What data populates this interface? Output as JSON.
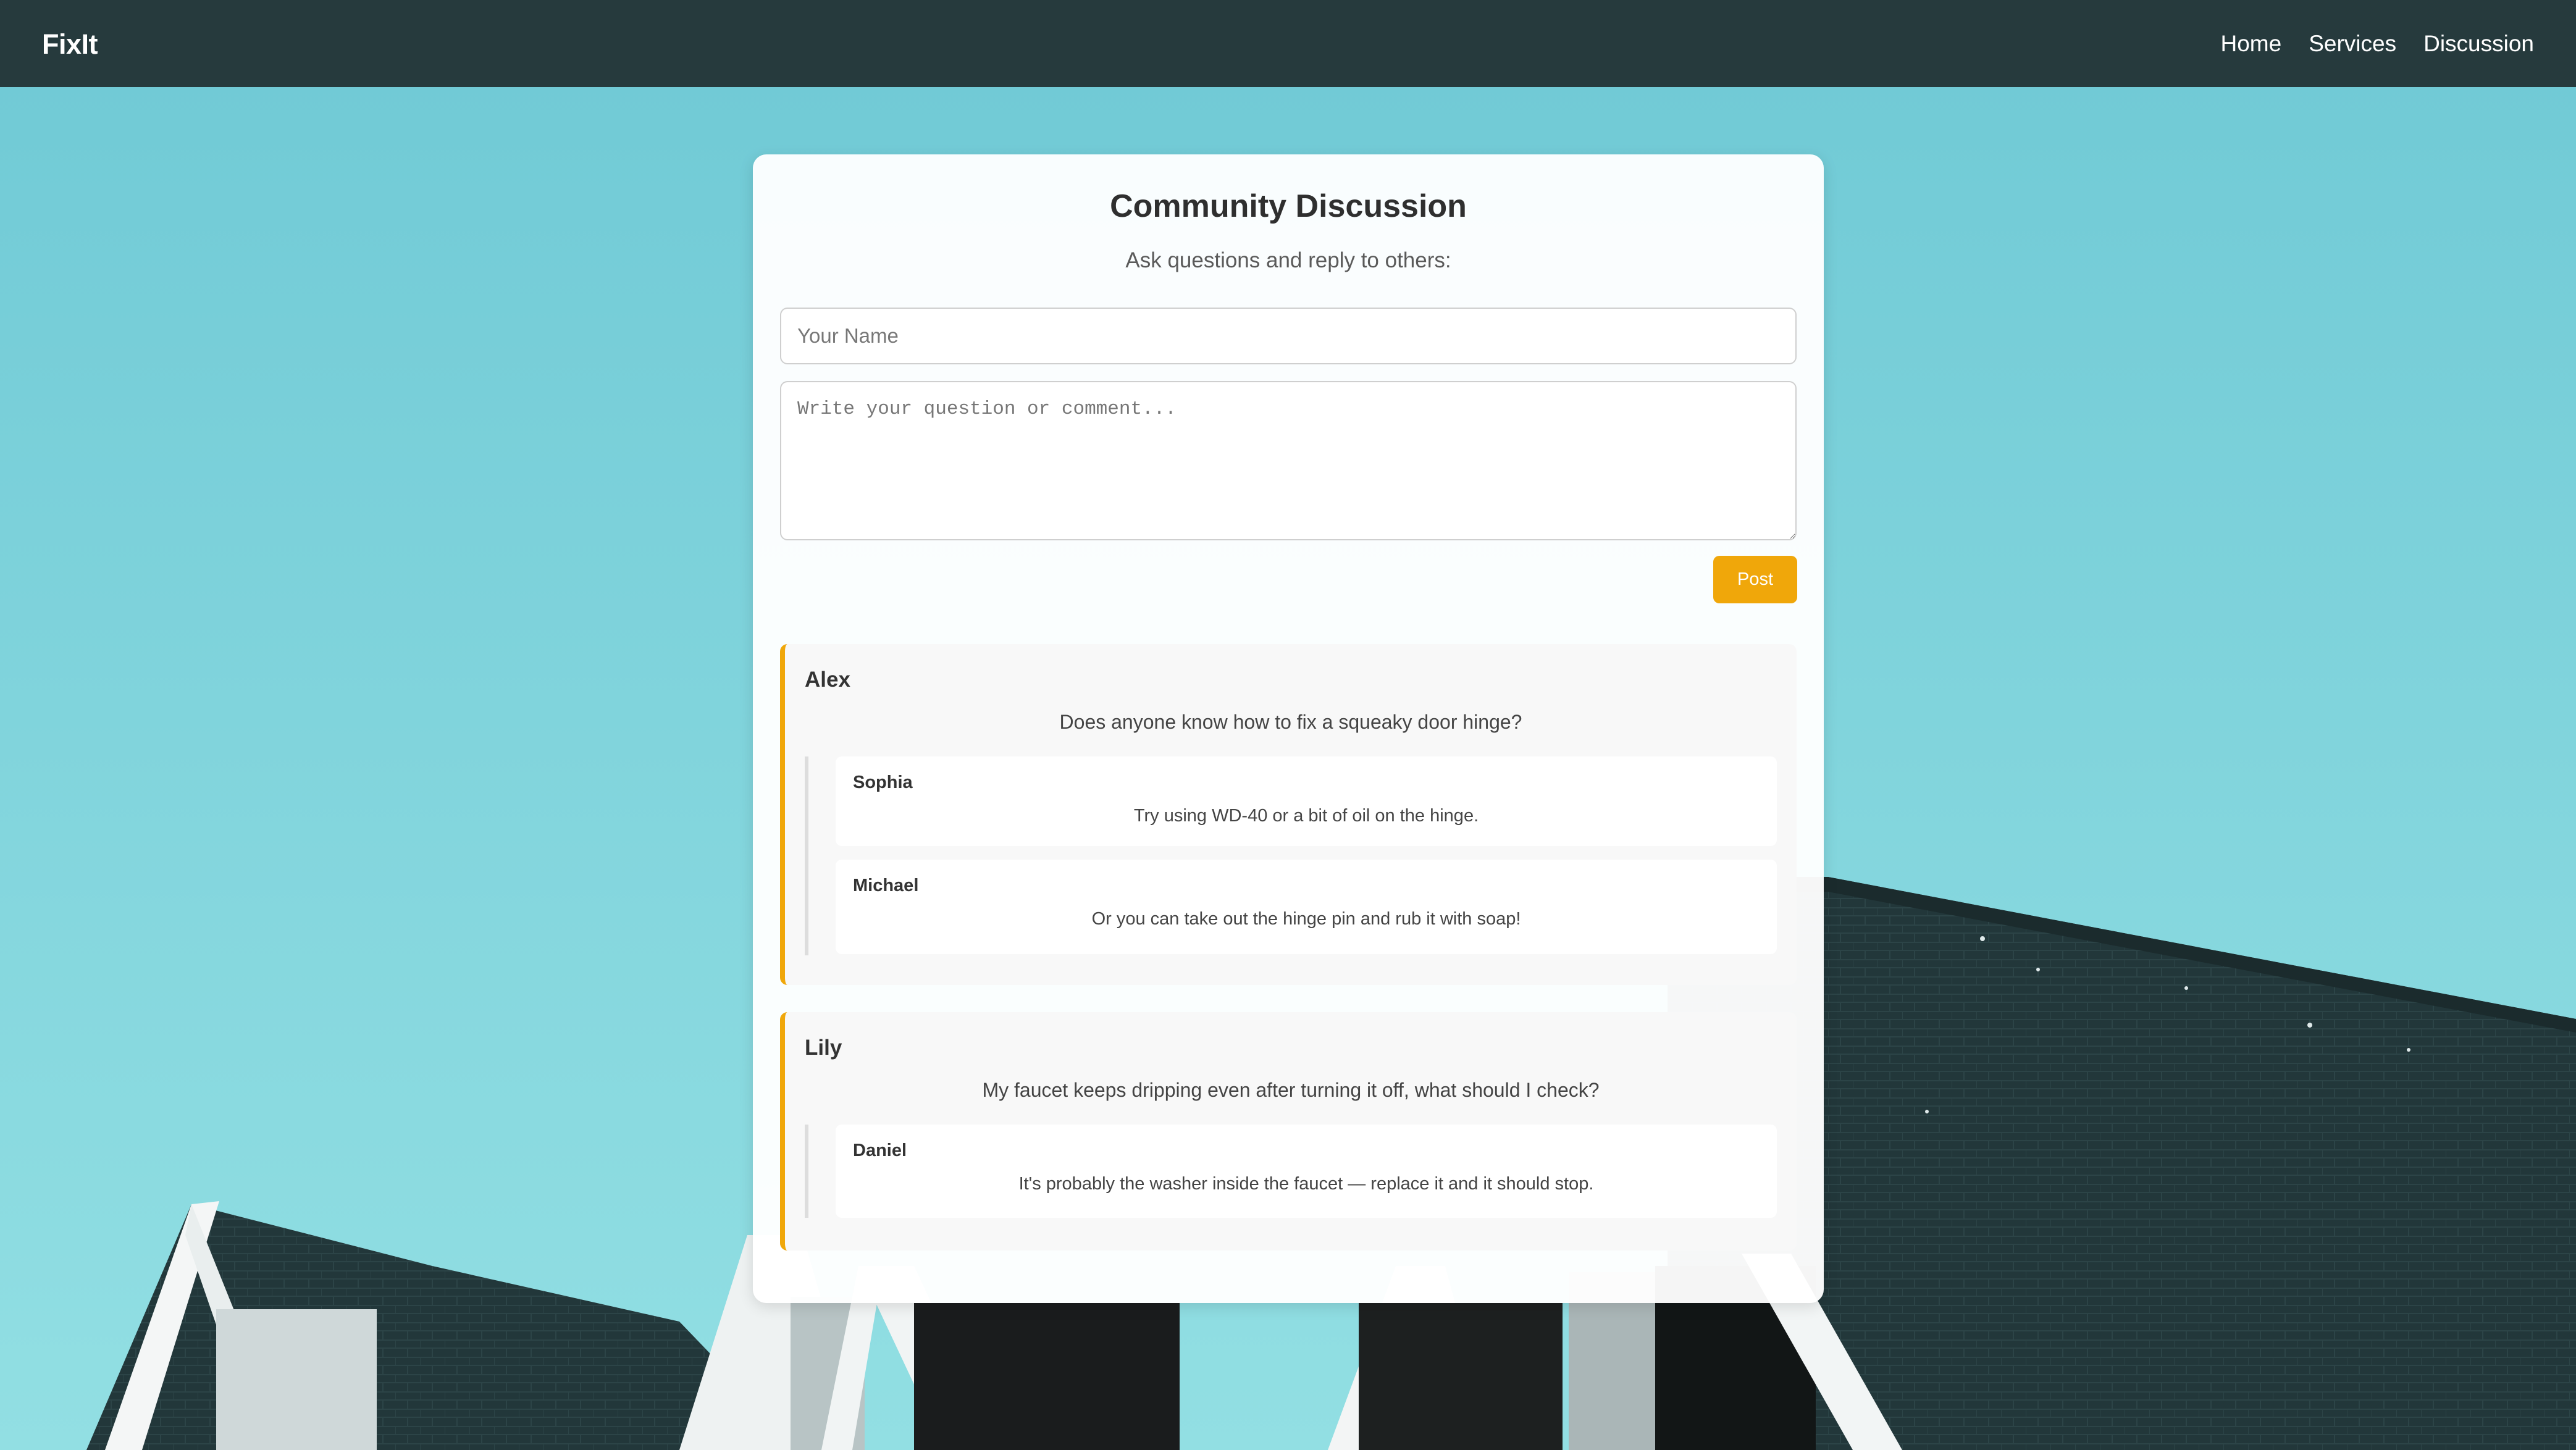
{
  "nav": {
    "brand": "FixIt",
    "links": [
      "Home",
      "Services",
      "Discussion"
    ]
  },
  "discussion": {
    "title": "Community Discussion",
    "subtitle": "Ask questions and reply to others:",
    "name_placeholder": "Your Name",
    "comment_placeholder": "Write your question or comment...",
    "post_label": "Post",
    "threads": [
      {
        "author": "Alex",
        "text": "Does anyone know how to fix a squeaky door hinge?",
        "replies": [
          {
            "author": "Sophia",
            "text": "Try using WD-40 or a bit of oil on the hinge."
          },
          {
            "author": "Michael",
            "text": "Or you can take out the hinge pin and rub it with soap!"
          }
        ]
      },
      {
        "author": "Lily",
        "text": "My faucet keeps dripping even after turning it off, what should I check?",
        "replies": [
          {
            "author": "Daniel",
            "text": "It's probably the washer inside the faucet — replace it and it should stop."
          }
        ]
      }
    ]
  },
  "colors": {
    "nav_bg": "#263a3d",
    "accent": "#f0a70a",
    "sky": "#79cfd8",
    "roof": "#233538"
  }
}
